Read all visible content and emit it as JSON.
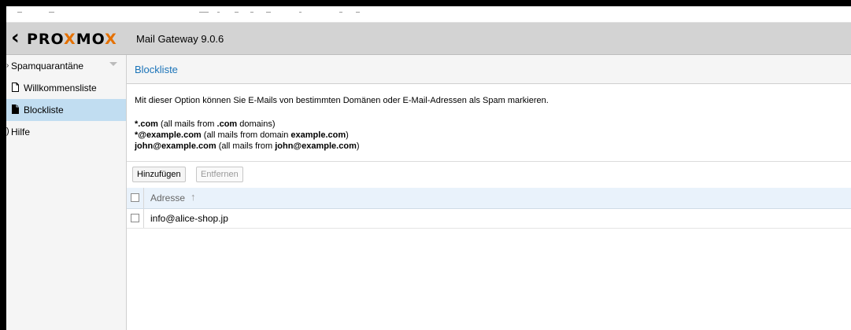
{
  "header": {
    "logo_prefix": "PRO",
    "logo_x1": "X",
    "logo_mid": "MO",
    "logo_x2": "X",
    "product": "Mail Gateway 9.0.6"
  },
  "sidebar": {
    "items": [
      {
        "label": "Spamquarantäne"
      },
      {
        "label": "Willkommensliste"
      },
      {
        "label": "Blockliste"
      },
      {
        "label": "Hilfe"
      }
    ]
  },
  "panel": {
    "title": "Blockliste",
    "description": "Mit dieser Option können Sie E-Mails von bestimmten Domänen oder E-Mail-Adressen als Spam markieren.",
    "examples": [
      {
        "pattern": "*.com",
        "text_a": " (all mails from ",
        "bold_b": ".com",
        "text_c": " domains)"
      },
      {
        "pattern": "*@example.com",
        "text_a": " (all mails from domain ",
        "bold_b": "example.com",
        "text_c": ")"
      },
      {
        "pattern": "john@example.com",
        "text_a": " (all mails from ",
        "bold_b": "john@example.com",
        "text_c": ")"
      }
    ]
  },
  "toolbar": {
    "add_label": "Hinzufügen",
    "remove_label": "Entfernen"
  },
  "grid": {
    "column_header": "Adresse",
    "sort_glyph": "↑",
    "rows": [
      {
        "address": "info@alice-shop.jp"
      }
    ]
  },
  "colors": {
    "accent": "#1a73b8",
    "logo_orange": "#e57000",
    "selected_bg": "#c1ddf1",
    "header_bg": "#d3d3d3"
  }
}
